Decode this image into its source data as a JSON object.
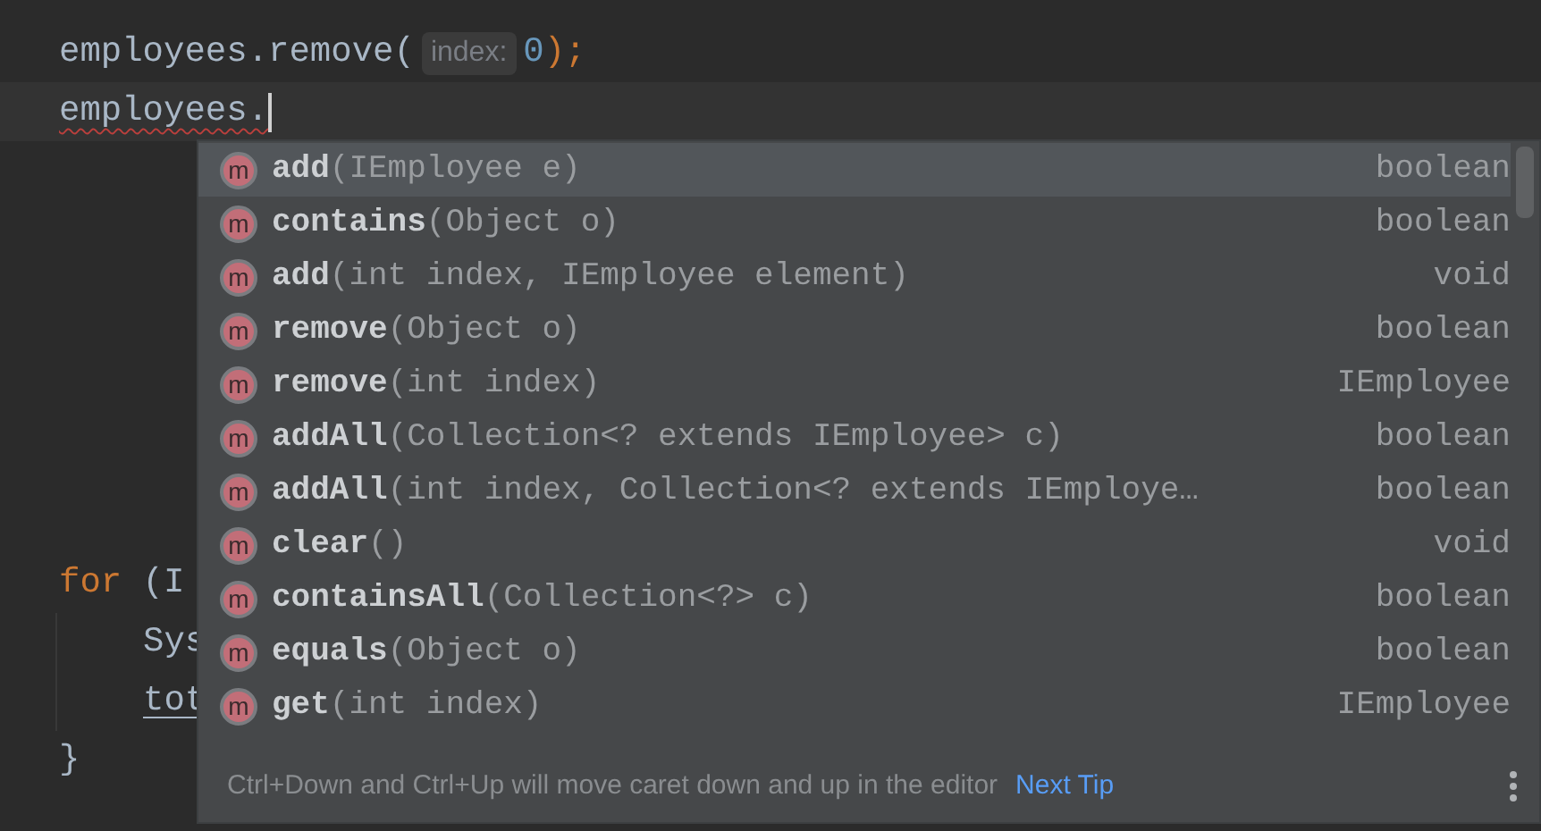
{
  "editor": {
    "lines": [
      {
        "kind": "remove_call",
        "code": "employees.remove(",
        "hint": "index:",
        "arg": "0",
        "close": ");",
        "current": false
      },
      {
        "kind": "error_line",
        "code": "employees.",
        "current": true
      },
      {
        "kind": "gap"
      },
      {
        "kind": "keyword_line",
        "keyword": "for",
        "code": " (I"
      },
      {
        "kind": "indented",
        "code": "Sys",
        "underlined": false
      },
      {
        "kind": "indented",
        "code": "tot",
        "underlined": true
      },
      {
        "kind": "plain",
        "code": "}"
      }
    ]
  },
  "completion": {
    "items": [
      {
        "icon": "m",
        "name": "add",
        "params": "(IEmployee e)",
        "type": "boolean",
        "selected": true
      },
      {
        "icon": "m",
        "name": "contains",
        "params": "(Object o)",
        "type": "boolean",
        "selected": false
      },
      {
        "icon": "m",
        "name": "add",
        "params": "(int index, IEmployee element)",
        "type": "void",
        "selected": false
      },
      {
        "icon": "m",
        "name": "remove",
        "params": "(Object o)",
        "type": "boolean",
        "selected": false
      },
      {
        "icon": "m",
        "name": "remove",
        "params": "(int index)",
        "type": "IEmployee",
        "selected": false
      },
      {
        "icon": "m",
        "name": "addAll",
        "params": "(Collection<? extends IEmployee> c)",
        "type": "boolean",
        "selected": false
      },
      {
        "icon": "m",
        "name": "addAll",
        "params": "(int index, Collection<? extends IEmploye…",
        "type": "boolean",
        "selected": false
      },
      {
        "icon": "m",
        "name": "clear",
        "params": "()",
        "type": "void",
        "selected": false
      },
      {
        "icon": "m",
        "name": "containsAll",
        "params": "(Collection<?> c)",
        "type": "boolean",
        "selected": false
      },
      {
        "icon": "m",
        "name": "equals",
        "params": "(Object o)",
        "type": "boolean",
        "selected": false
      },
      {
        "icon": "m",
        "name": "get",
        "params": "(int index)",
        "type": "IEmployee",
        "selected": false
      }
    ],
    "tip": "Ctrl+Down and Ctrl+Up will move caret down and up in the editor",
    "tip_link": "Next Tip"
  }
}
